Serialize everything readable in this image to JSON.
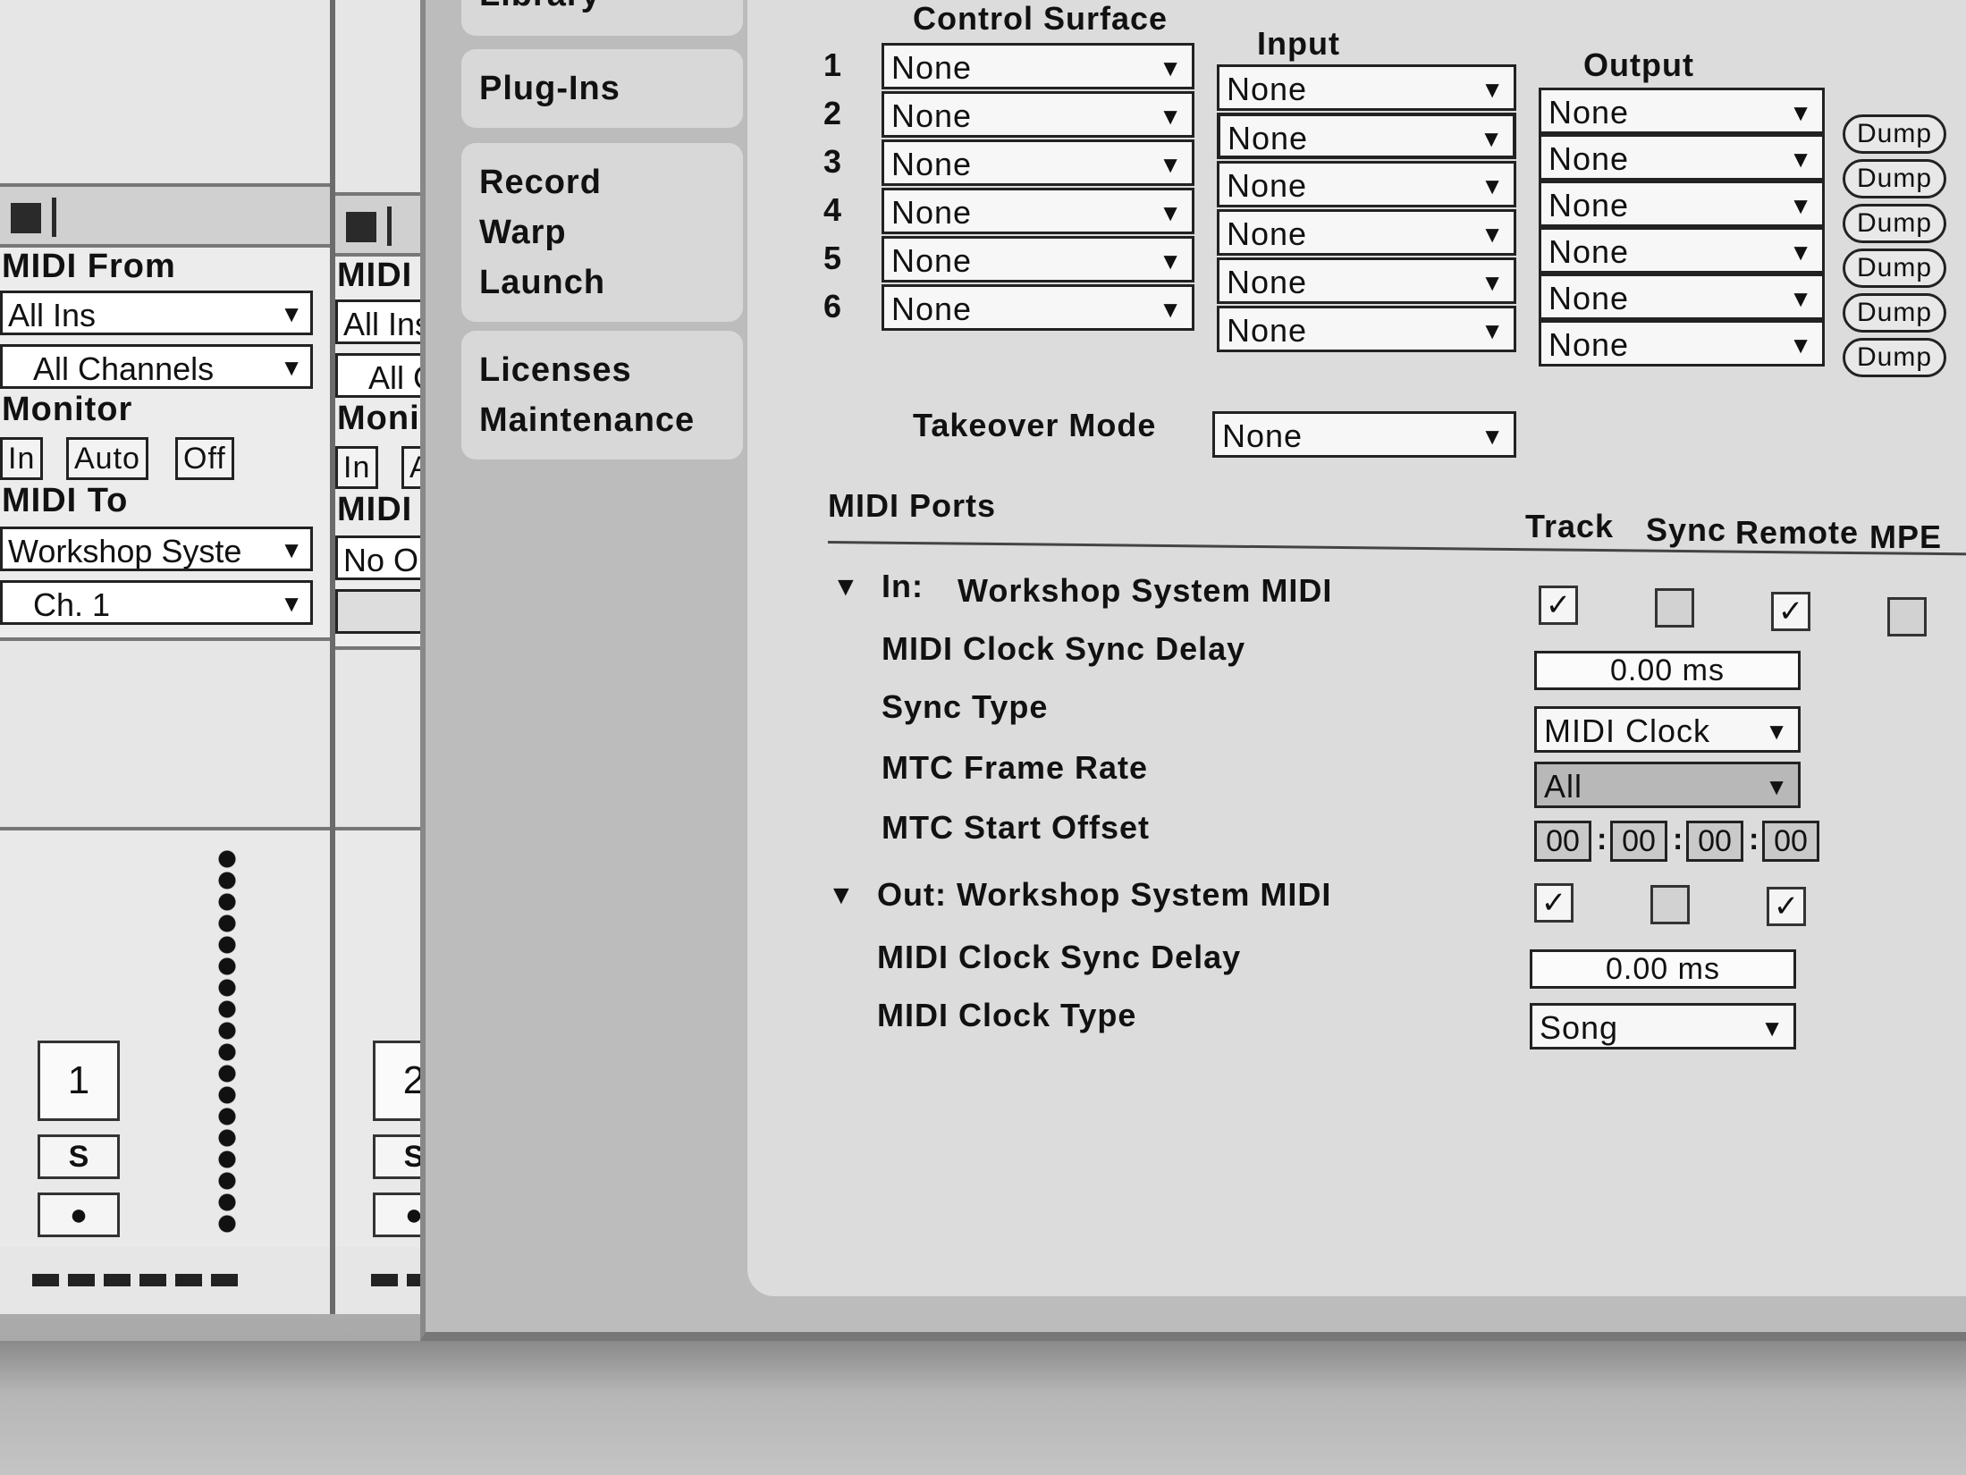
{
  "tracks": [
    {
      "midi_from_label": "MIDI From",
      "midi_from_value": "All Ins",
      "channel_value": "All Channels",
      "monitor_label": "Monitor",
      "monitor_in": "In",
      "monitor_auto": "Auto",
      "monitor_off": "Off",
      "midi_to_label": "MIDI To",
      "midi_to_value": "Workshop Syste",
      "midi_to_channel": "Ch. 1",
      "number": "1",
      "solo": "S"
    },
    {
      "midi_from_label": "MIDI F",
      "midi_from_value": "All Ins",
      "channel_value": "All C",
      "monitor_label": "Monit",
      "monitor_in": "In",
      "monitor_auto": "A",
      "midi_to_label": "MIDI T",
      "midi_to_value": "No Ou",
      "number": "2",
      "solo": "S"
    }
  ],
  "prefs_tabs": [
    {
      "label": "Library"
    },
    {
      "label": "Plug-Ins"
    },
    {
      "label": "Record"
    },
    {
      "label": "Warp"
    },
    {
      "label": "Launch"
    },
    {
      "label": "Licenses"
    },
    {
      "label": "Maintenance"
    }
  ],
  "control_surface": {
    "header_surface": "Control Surface",
    "header_input": "Input",
    "header_output": "Output",
    "dump_label": "Dump",
    "rows": [
      {
        "num": "1",
        "surface": "None",
        "input": "None",
        "output": "None"
      },
      {
        "num": "2",
        "surface": "None",
        "input": "None",
        "output": "None"
      },
      {
        "num": "3",
        "surface": "None",
        "input": "None",
        "output": "None"
      },
      {
        "num": "4",
        "surface": "None",
        "input": "None",
        "output": "None"
      },
      {
        "num": "5",
        "surface": "None",
        "input": "None",
        "output": "None"
      },
      {
        "num": "6",
        "surface": "None",
        "input": "None",
        "output": "None"
      }
    ],
    "takeover_label": "Takeover Mode",
    "takeover_value": "None"
  },
  "midi_ports": {
    "title": "MIDI Ports",
    "col_track": "Track",
    "col_sync": "Sync",
    "col_remote": "Remote",
    "col_mpe": "MPE",
    "in_prefix": "In:",
    "in_name": "Workshop System MIDI",
    "in_checks": {
      "track": true,
      "sync": false,
      "remote": true,
      "mpe": false
    },
    "in_clock_delay_label": "MIDI Clock Sync Delay",
    "in_clock_delay_value": "0.00 ms",
    "sync_type_label": "Sync Type",
    "sync_type_value": "MIDI Clock",
    "mtc_rate_label": "MTC Frame Rate",
    "mtc_rate_value": "All",
    "mtc_offset_label": "MTC Start Offset",
    "mtc_offset": [
      "00",
      "00",
      "00",
      "00"
    ],
    "out_label": "Out: Workshop System MIDI",
    "out_checks": {
      "track": true,
      "sync": false,
      "remote": true
    },
    "out_clock_delay_label": "MIDI Clock Sync Delay",
    "out_clock_delay_value": "0.00 ms",
    "clock_type_label": "MIDI Clock Type",
    "clock_type_value": "Song"
  },
  "glyphs": {
    "arrow": "▼",
    "check": "✓",
    "triangle": "▼",
    "colon": ":"
  }
}
